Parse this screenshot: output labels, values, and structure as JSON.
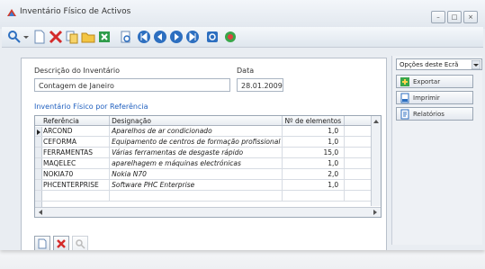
{
  "window": {
    "title": "Inventário Físico de Activos"
  },
  "form": {
    "description_label": "Descrição do Inventário",
    "description_value": "Contagem de Janeiro",
    "date_label": "Data",
    "date_value": "28.01.2009",
    "section_title": "Inventário Físico por Referência"
  },
  "grid": {
    "columns": [
      "Referência",
      "Designação",
      "Nº de elementos"
    ],
    "rows": [
      {
        "ref": "ARCOND",
        "des": "Aparelhos de ar condicionado",
        "qty": "1,0"
      },
      {
        "ref": "CEFORMA",
        "des": "Equipamento de centros de formação profissional",
        "qty": "1,0"
      },
      {
        "ref": "FERRAMENTAS",
        "des": "Várias ferramentas de desgaste rápido",
        "qty": "15,0"
      },
      {
        "ref": "MAQELEC",
        "des": "aparelhagem e máquinas electrónicas",
        "qty": "1,0"
      },
      {
        "ref": "NOKIA70",
        "des": "Nokia N70",
        "qty": "2,0"
      },
      {
        "ref": "PHCENTERPRISE",
        "des": "Software PHC Enterprise",
        "qty": "1,0"
      }
    ]
  },
  "side": {
    "select_value": "Opções deste Ecrã",
    "buttons": [
      "Exportar",
      "Imprimir",
      "Relatórios"
    ]
  }
}
